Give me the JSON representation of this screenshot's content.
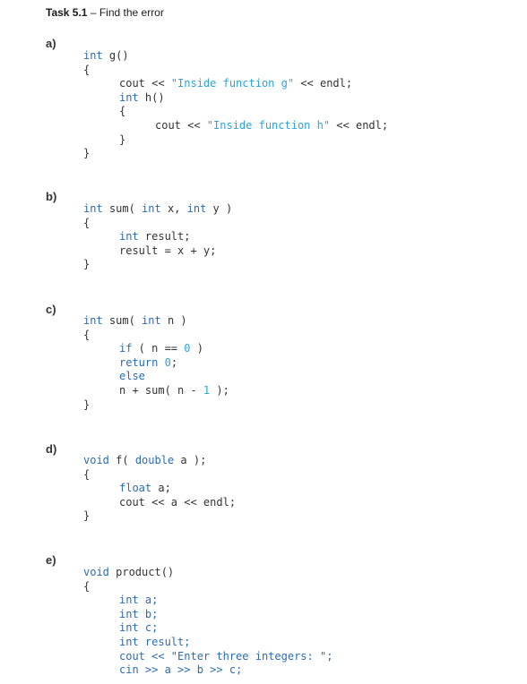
{
  "title": {
    "bold": "Task 5.1",
    "rest": " – Find the error"
  },
  "sections": [
    {
      "label": "a)",
      "lines": [
        {
          "indent": 0,
          "tokens": [
            {
              "t": "int",
              "c": "kw"
            },
            {
              "t": " g()",
              "c": "id"
            }
          ]
        },
        {
          "indent": 0,
          "tokens": [
            {
              "t": "{",
              "c": "id"
            }
          ]
        },
        {
          "indent": 1,
          "tokens": [
            {
              "t": "cout << ",
              "c": "id"
            },
            {
              "t": "\"Inside function g\"",
              "c": "str"
            },
            {
              "t": " << endl;",
              "c": "id"
            }
          ]
        },
        {
          "indent": 1,
          "tokens": [
            {
              "t": "int",
              "c": "kw"
            },
            {
              "t": " h()",
              "c": "id"
            }
          ]
        },
        {
          "indent": 1,
          "tokens": [
            {
              "t": "{",
              "c": "id"
            }
          ]
        },
        {
          "indent": 2,
          "tokens": [
            {
              "t": "cout << ",
              "c": "id"
            },
            {
              "t": "\"Inside function h\"",
              "c": "str"
            },
            {
              "t": " << endl;",
              "c": "id"
            }
          ]
        },
        {
          "indent": 1,
          "tokens": [
            {
              "t": "}",
              "c": "id"
            }
          ]
        },
        {
          "indent": 0,
          "tokens": [
            {
              "t": "}",
              "c": "id"
            }
          ]
        }
      ]
    },
    {
      "label": "b)",
      "lines": [
        {
          "indent": 0,
          "tokens": [
            {
              "t": "int",
              "c": "kw"
            },
            {
              "t": " sum( ",
              "c": "id"
            },
            {
              "t": "int",
              "c": "kw"
            },
            {
              "t": " x, ",
              "c": "id"
            },
            {
              "t": "int",
              "c": "kw"
            },
            {
              "t": " y )",
              "c": "id"
            }
          ]
        },
        {
          "indent": 0,
          "tokens": [
            {
              "t": "{",
              "c": "id"
            }
          ]
        },
        {
          "indent": 1,
          "tokens": [
            {
              "t": "int",
              "c": "kw"
            },
            {
              "t": " result;",
              "c": "id"
            }
          ]
        },
        {
          "indent": 1,
          "tokens": [
            {
              "t": "result = x + y;",
              "c": "id"
            }
          ]
        },
        {
          "indent": 0,
          "tokens": [
            {
              "t": "}",
              "c": "id"
            }
          ]
        }
      ]
    },
    {
      "label": "c)",
      "lines": [
        {
          "indent": 0,
          "tokens": [
            {
              "t": "int",
              "c": "kw"
            },
            {
              "t": " sum( ",
              "c": "id"
            },
            {
              "t": "int",
              "c": "kw"
            },
            {
              "t": " n )",
              "c": "id"
            }
          ]
        },
        {
          "indent": 0,
          "tokens": [
            {
              "t": "{",
              "c": "id"
            }
          ]
        },
        {
          "indent": 1,
          "tokens": [
            {
              "t": "if",
              "c": "kw"
            },
            {
              "t": " ( n == ",
              "c": "id"
            },
            {
              "t": "0",
              "c": "num"
            },
            {
              "t": " )",
              "c": "id"
            }
          ]
        },
        {
          "indent": 1,
          "tokens": [
            {
              "t": "return",
              "c": "kw"
            },
            {
              "t": " ",
              "c": "id"
            },
            {
              "t": "0",
              "c": "num"
            },
            {
              "t": ";",
              "c": "id"
            }
          ]
        },
        {
          "indent": 1,
          "tokens": [
            {
              "t": "else",
              "c": "kw"
            }
          ]
        },
        {
          "indent": 1,
          "tokens": [
            {
              "t": "n + sum( n - ",
              "c": "id"
            },
            {
              "t": "1",
              "c": "num"
            },
            {
              "t": " );",
              "c": "id"
            }
          ]
        },
        {
          "indent": 0,
          "tokens": [
            {
              "t": "}",
              "c": "id"
            }
          ]
        }
      ]
    },
    {
      "label": "d)",
      "lines": [
        {
          "indent": 0,
          "tokens": [
            {
              "t": "void",
              "c": "kw"
            },
            {
              "t": " f( ",
              "c": "id"
            },
            {
              "t": "double",
              "c": "kw"
            },
            {
              "t": " a );",
              "c": "id"
            }
          ]
        },
        {
          "indent": 0,
          "tokens": [
            {
              "t": "{",
              "c": "id"
            }
          ]
        },
        {
          "indent": 1,
          "tokens": [
            {
              "t": "float",
              "c": "kw"
            },
            {
              "t": " a;",
              "c": "id"
            }
          ]
        },
        {
          "indent": 1,
          "tokens": [
            {
              "t": "cout << a << endl;",
              "c": "id"
            }
          ]
        },
        {
          "indent": 0,
          "tokens": [
            {
              "t": "}",
              "c": "id"
            }
          ]
        }
      ]
    },
    {
      "label": "e)",
      "lines": [
        {
          "indent": 0,
          "tokens": [
            {
              "t": "void",
              "c": "kw"
            },
            {
              "t": " product()",
              "c": "id"
            }
          ]
        },
        {
          "indent": 0,
          "tokens": [
            {
              "t": "{",
              "c": "id"
            }
          ]
        },
        {
          "indent": 1,
          "tokens": [
            {
              "t": "int a;",
              "c": "blue"
            }
          ]
        },
        {
          "indent": 1,
          "tokens": [
            {
              "t": "int b;",
              "c": "blue"
            }
          ]
        },
        {
          "indent": 1,
          "tokens": [
            {
              "t": "int c;",
              "c": "blue"
            }
          ]
        },
        {
          "indent": 1,
          "tokens": [
            {
              "t": "int result;",
              "c": "blue"
            }
          ]
        },
        {
          "indent": 1,
          "tokens": [
            {
              "t": "cout << \"Enter three integers: \";",
              "c": "blue"
            }
          ]
        },
        {
          "indent": 1,
          "tokens": [
            {
              "t": "cin >> a >> b >> c;",
              "c": "blue"
            }
          ]
        }
      ]
    }
  ]
}
